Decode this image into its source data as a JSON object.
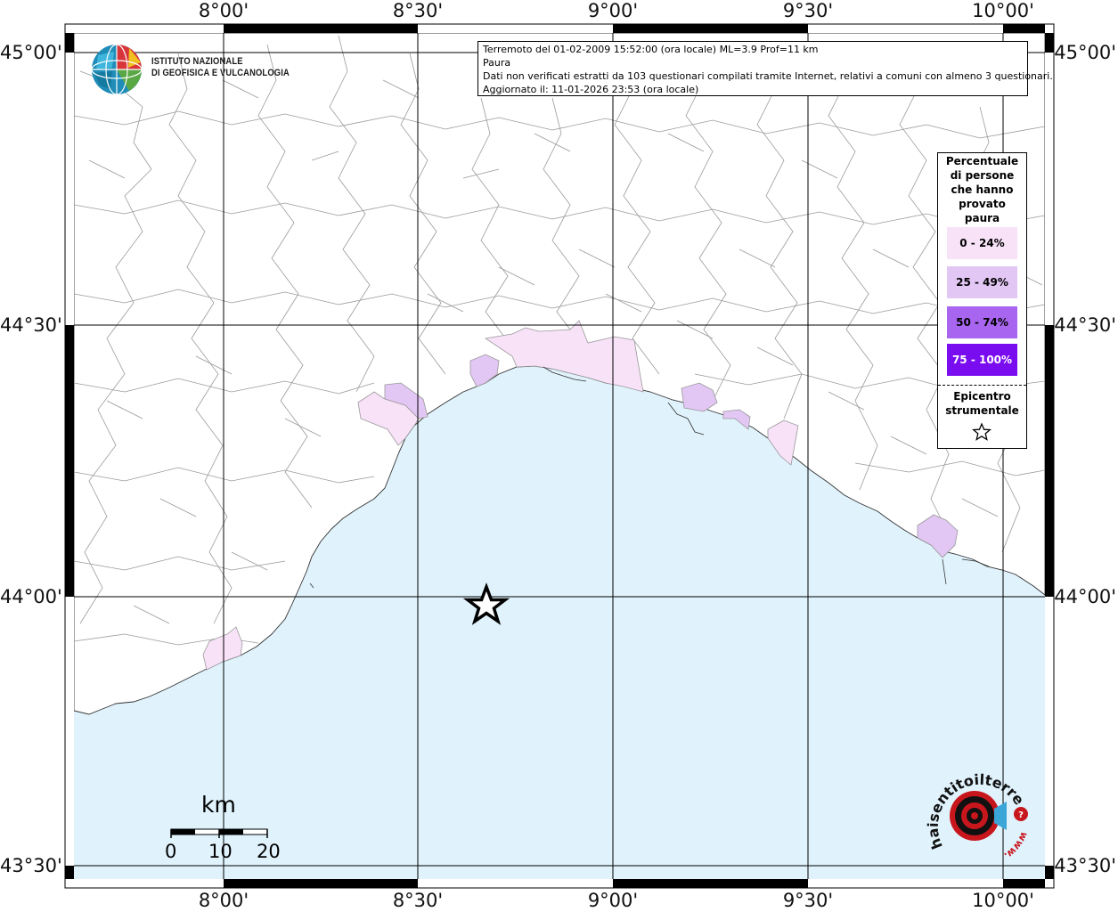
{
  "title": "Terremoto del 01-02-2009 15:52:00 (ora locale) ML=3.9 Prof=11 km",
  "subtitle": "Paura",
  "note": "Dati non verificati estratti da 103 questionari compilati tramite Internet, relativi a comuni con almeno 3 questionari.",
  "updated": "Aggiornato il: 11-01-2026 23:53 (ora locale)",
  "institute_name": {
    "line1": "ISTITUTO NAZIONALE",
    "line2": "DI GEOFISICA E VULCANOLOGIA"
  },
  "longitude_labels": [
    "8°00'",
    "8°30'",
    "9°00'",
    "9°30'",
    "10°00'"
  ],
  "latitude_labels": [
    "45°00'",
    "44°30'",
    "44°00'",
    "43°30'"
  ],
  "legend": {
    "title": "Percentuale di persone che hanno provato paura",
    "classes": [
      {
        "label": "0 - 24%",
        "color": "#f8e2f8"
      },
      {
        "label": "25 - 49%",
        "color": "#e2c6f4"
      },
      {
        "label": "50 - 74%",
        "color": "#a866f0"
      },
      {
        "label": "75 - 100%",
        "color": "#7a0cf0"
      }
    ],
    "epicenter_label": "Epicentro strumentale"
  },
  "scale_bar": {
    "unit": "km",
    "ticks": [
      "0",
      "10",
      "20"
    ]
  },
  "epicenter": {
    "lon": 8.65,
    "lat": 43.98
  },
  "colors": {
    "sea": "#e0f2fc",
    "land": "#ffffff",
    "boundaries": "#9a9a9a",
    "grid": "#000000"
  },
  "hst_logo_text": {
    "main": "haisentitoilterremoto.it",
    "prefix": "www."
  }
}
